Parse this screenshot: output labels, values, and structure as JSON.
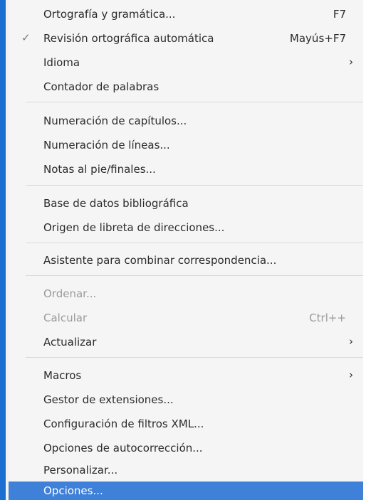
{
  "menu": {
    "items": [
      {
        "label": "Ortografía y gramática...",
        "shortcut": "F7"
      },
      {
        "label": "Revisión ortográfica automática",
        "shortcut": "Mayús+F7"
      },
      {
        "label": "Idioma"
      },
      {
        "label": "Contador de palabras"
      },
      {
        "label": "Numeración de capítulos..."
      },
      {
        "label": "Numeración de líneas..."
      },
      {
        "label": "Notas al pie/finales..."
      },
      {
        "label": "Base de datos bibliográfica"
      },
      {
        "label": "Origen de libreta de direcciones..."
      },
      {
        "label": "Asistente para combinar correspondencia..."
      },
      {
        "label": "Ordenar..."
      },
      {
        "label": "Calcular",
        "shortcut": "Ctrl++"
      },
      {
        "label": "Actualizar"
      },
      {
        "label": "Macros"
      },
      {
        "label": "Gestor de extensiones..."
      },
      {
        "label": "Configuración de filtros XML..."
      },
      {
        "label": "Opciones de autocorrección..."
      },
      {
        "label": "Personalizar..."
      },
      {
        "label": "Opciones..."
      }
    ],
    "check_icon": "✓",
    "arrow_icon": "›"
  },
  "colors": {
    "highlight": "#3f80d8",
    "accent_edge": "#1a6fd0",
    "disabled_text": "#9a9a9a"
  }
}
